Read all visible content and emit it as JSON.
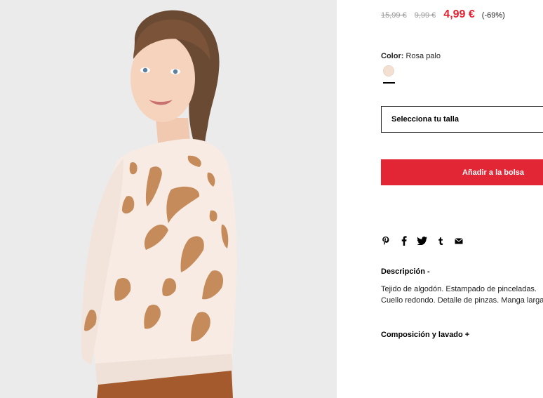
{
  "product": {
    "old_prices": [
      "15,99 €",
      "9,99 €"
    ],
    "price": "4,99 €",
    "discount": "(-69%)",
    "color_label": "Color:",
    "color_name": "Rosa palo",
    "swatch_color": "#f3e0d3",
    "size_placeholder": "Selecciona tu talla",
    "add_to_bag": "Añadir a la bolsa"
  },
  "share": {
    "icons": [
      "pinterest-icon",
      "facebook-icon",
      "twitter-icon",
      "tumblr-icon",
      "email-icon"
    ]
  },
  "description": {
    "title": "Descripción -",
    "body": "Tejido de algodón. Estampado de pinceladas. Cuello redondo. Detalle de pinzas. Manga larga.",
    "composition_title": "Composición y lavado +"
  },
  "colors": {
    "accent": "#e32636",
    "sale_price": "#e3202f"
  }
}
